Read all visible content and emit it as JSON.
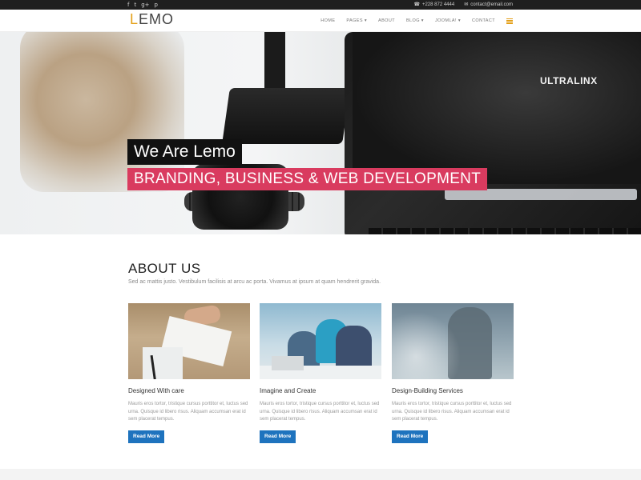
{
  "topbar": {
    "social_icons": [
      "facebook-icon",
      "twitter-icon",
      "google-plus-icon",
      "pinterest-icon"
    ],
    "social_glyphs": [
      "f",
      "t",
      "g+",
      "p"
    ],
    "phone": "+228 872 4444",
    "email": "contact@email.com"
  },
  "nav": {
    "logo_accent": "L",
    "logo_rest": "EMO",
    "items": [
      "HOME",
      "PAGES ▾",
      "ABOUT",
      "BLOG ▾",
      "JOOMLA! ▾",
      "CONTACT"
    ],
    "accent_color": "#e4a11b"
  },
  "hero": {
    "title": "We Are Lemo",
    "subtitle": "BRANDING, BUSINESS & WEB DEVELOPMENT",
    "screen_text": "ULTRALINX",
    "subtitle_bg": "#d93b5f"
  },
  "about": {
    "heading": "ABOUT US",
    "intro": "Sed ac mattis justo. Vestibulum facilisis at arcu ac porta. Vivamus at ipsum at quam hendrerit gravida.",
    "cards": [
      {
        "title": "Designed With care",
        "text": "Mauris eros tortor, tristique cursus porttitor et, luctus sed urna. Quisque id libero risus. Aliquam accumsan erat id sem placerat tempus.",
        "button": "Read More"
      },
      {
        "title": "Imagine and Create",
        "text": "Mauris eros tortor, tristique cursus porttitor et, luctus sed urna. Quisque id libero risus. Aliquam accumsan erat id sem placerat tempus.",
        "button": "Read More"
      },
      {
        "title": "Design-Building Services",
        "text": "Mauris eros tortor, tristique cursus porttitor et, luctus sed urna. Quisque id libero risus. Aliquam accumsan erat id sem placerat tempus.",
        "button": "Read More"
      }
    ],
    "button_color": "#1e73be"
  }
}
